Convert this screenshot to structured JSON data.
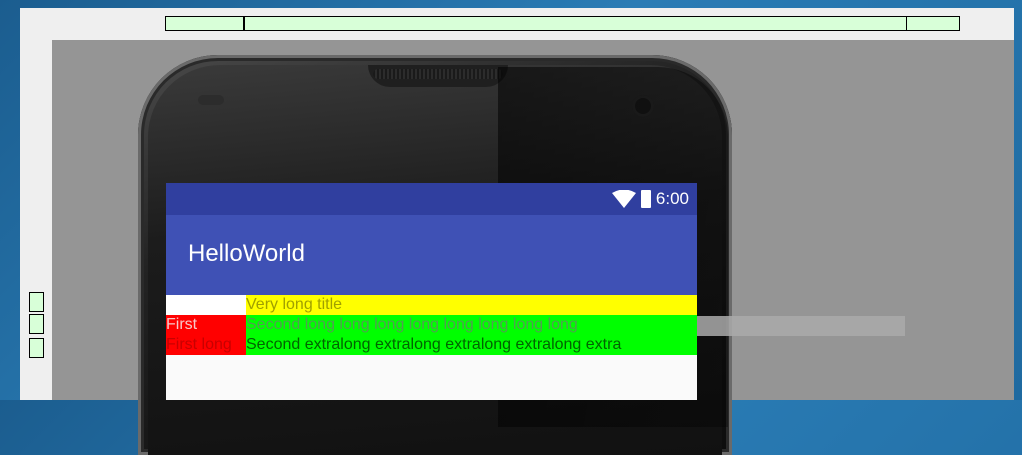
{
  "app": {
    "title": "HelloWorld",
    "status_time": "6:00"
  },
  "rows": [
    {
      "left": "",
      "right": "Very long title"
    },
    {
      "left": "First",
      "right": "Second long long long long long long long long"
    },
    {
      "left": "First long",
      "right": "Second extralong extralong extralong extralong extra"
    }
  ],
  "colors": {
    "status_bar": "#303f9f",
    "app_bar": "#3f51b5",
    "yellow_cell": "#ffff00",
    "green_cell": "#00ff00",
    "red_cell": "#ff0000"
  },
  "icons": {
    "wifi": "wifi-icon",
    "battery": "battery-icon"
  }
}
